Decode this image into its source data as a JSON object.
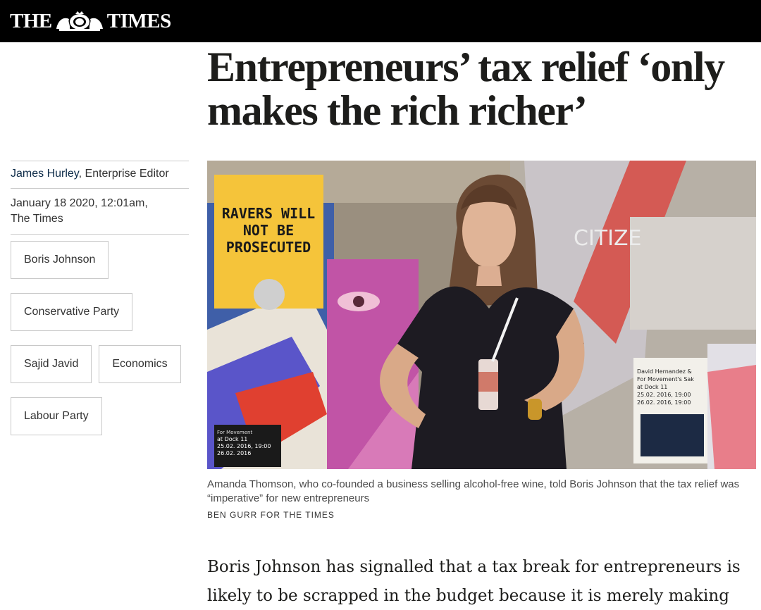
{
  "masthead": {
    "logo_left": "THE",
    "logo_right": "TIMES",
    "background": "#000000",
    "crest_icon": "royal-crest-icon"
  },
  "article": {
    "headline": "Entrepreneurs’ tax relief ‘only makes the rich richer’",
    "author": "James Hurley",
    "author_role": ", Enterprise Editor",
    "date": "January 18 2020, 12:01am,",
    "publication": "The Times",
    "tags": [
      "Boris Johnson",
      "Conservative Party",
      "Sajid Javid",
      "Economics",
      "Labour Party"
    ],
    "photo": {
      "poster_text": [
        "RAVERS WILL",
        "NOT BE",
        "PROSECUTED"
      ],
      "flyer_text": [
        "David Hernandez &",
        "For Movement's Sak",
        "at Dock 11",
        "25.02. 2016, 19:00",
        "26.02. 2016, 19:00"
      ],
      "wall_text": "CITIZE",
      "small_flyer": [
        "For Movement",
        "at Dock 11",
        "25.02. 2016, 19:00",
        "26.02. 2016"
      ]
    },
    "caption": "Amanda Thomson, who co-founded a business selling alcohol-free wine, told Boris Johnson that the tax relief was “imperative” for new entrepreneurs",
    "credit": "BEN GURR FOR THE TIMES",
    "body": "Boris Johnson has signalled that a tax break for entrepreneurs is likely to be scrapped in the budget because it is merely making"
  }
}
